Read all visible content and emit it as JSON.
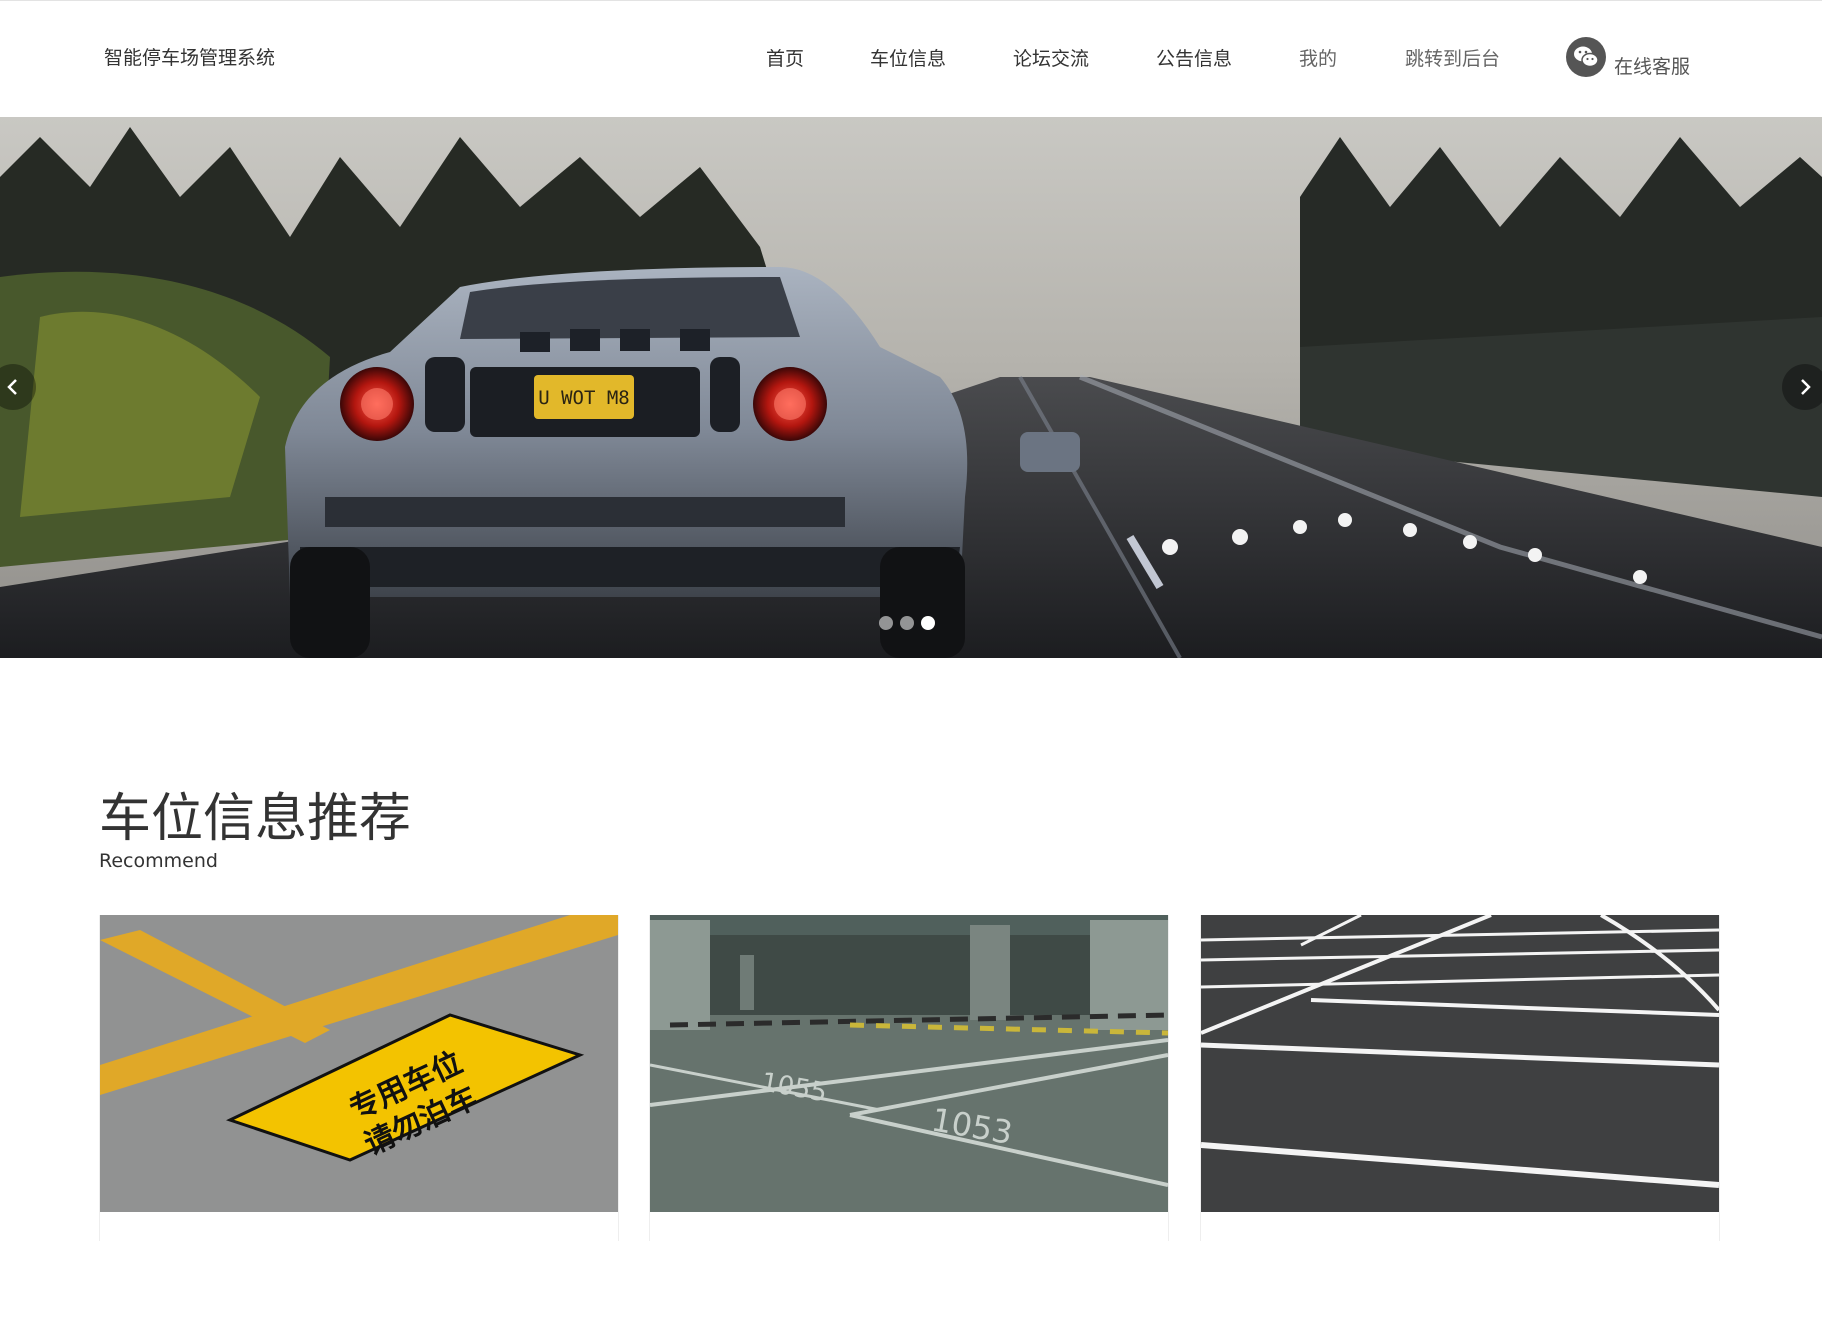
{
  "header": {
    "title": "智能停车场管理系统",
    "nav": [
      {
        "label": "首页"
      },
      {
        "label": "车位信息"
      },
      {
        "label": "论坛交流"
      },
      {
        "label": "公告信息"
      },
      {
        "label": "我的"
      },
      {
        "label": "跳转到后台"
      }
    ],
    "service": {
      "label": "在线客服",
      "icon": "wechat-icon"
    }
  },
  "banner": {
    "plate": "U WOT M8",
    "slides": 3,
    "active_slide": 3,
    "prev_icon": "chevron-left-icon",
    "next_icon": "chevron-right-icon"
  },
  "recommend": {
    "title": "车位信息推荐",
    "subtitle": "Recommend",
    "cards": [
      {
        "sign_line1": "专用车位",
        "sign_line2": "请勿泊车"
      },
      {
        "stall_a": "1055",
        "stall_b": "1053"
      },
      {}
    ]
  },
  "colors": {
    "accent_yellow": "#f2c200",
    "text": "#333333"
  }
}
